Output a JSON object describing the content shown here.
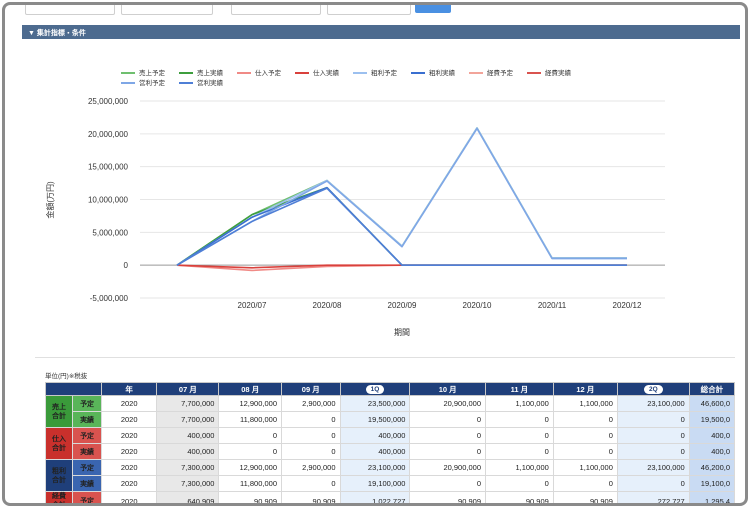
{
  "filters": {
    "field1_placeholder": "",
    "field2_placeholder": "",
    "field3_placeholder": "",
    "field4_placeholder": ""
  },
  "section": {
    "title": "▼ 集計指標・条件"
  },
  "legend": [
    {
      "label": "売上予定",
      "color": "#6fbf6f"
    },
    {
      "label": "売上実績",
      "color": "#3e9e3e"
    },
    {
      "label": "仕入予定",
      "color": "#f08a86"
    },
    {
      "label": "仕入実績",
      "color": "#d9413c"
    },
    {
      "label": "粗利予定",
      "color": "#9cc0ef"
    },
    {
      "label": "粗利実績",
      "color": "#3a6fd0"
    },
    {
      "label": "経費予定",
      "color": "#f2a49a"
    },
    {
      "label": "経費実績",
      "color": "#d9534f"
    },
    {
      "label": "営利予定",
      "color": "#7fa7e6"
    },
    {
      "label": "営利実績",
      "color": "#4f7fd6"
    }
  ],
  "chart_data": {
    "type": "line",
    "x": [
      "",
      "2020/07",
      "2020/08",
      "2020/09",
      "2020/10",
      "2020/11",
      "2020/12"
    ],
    "ylabel": "金額(万円)",
    "xlabel": "期間",
    "ylim": [
      -5000000,
      25000000
    ],
    "yticks": [
      "25,000,000",
      "20,000,000",
      "15,000,000",
      "10,000,000",
      "5,000,000",
      "0",
      "-5,000,000"
    ],
    "series": [
      {
        "name": "売上予定",
        "color": "#6fbf6f",
        "values": [
          0,
          7700000,
          12900000,
          2900000,
          20900000,
          1100000,
          1100000
        ]
      },
      {
        "name": "売上実績",
        "color": "#3e9e3e",
        "values": [
          0,
          7700000,
          11800000,
          0,
          0,
          0,
          0
        ]
      },
      {
        "name": "仕入予定",
        "color": "#f08a86",
        "values": [
          0,
          -800000,
          -200000,
          0,
          0,
          0,
          0
        ]
      },
      {
        "name": "仕入実績",
        "color": "#d9413c",
        "values": [
          0,
          -400000,
          0,
          0,
          0,
          0,
          0
        ]
      },
      {
        "name": "粗利予定",
        "color": "#9cc0ef",
        "values": [
          0,
          7300000,
          12900000,
          2900000,
          20900000,
          1100000,
          1100000
        ]
      },
      {
        "name": "粗利実績",
        "color": "#3a6fd0",
        "values": [
          0,
          7300000,
          11800000,
          0,
          0,
          0,
          0
        ]
      },
      {
        "name": "営利予定",
        "color": "#7fa7e6",
        "values": [
          0,
          6660000,
          12810000,
          2810000,
          20810000,
          1010000,
          1010000
        ]
      },
      {
        "name": "営利実績",
        "color": "#4f7fd6",
        "values": [
          0,
          6660000,
          11710000,
          0,
          0,
          0,
          0
        ]
      }
    ]
  },
  "table": {
    "unit_label": "単位(円)※税抜",
    "headers": [
      "年",
      "07 月",
      "08 月",
      "09 月",
      "1Q",
      "10 月",
      "11 月",
      "12 月",
      "2Q",
      "総合計"
    ],
    "groups": [
      {
        "name": "売上\n合計",
        "color": "green",
        "rows": [
          {
            "sub": "予定",
            "values": [
              "2020",
              "7,700,000",
              "12,900,000",
              "2,900,000",
              "23,500,000",
              "20,900,000",
              "1,100,000",
              "1,100,000",
              "23,100,000",
              "46,600,0"
            ]
          },
          {
            "sub": "実績",
            "values": [
              "2020",
              "7,700,000",
              "11,800,000",
              "0",
              "19,500,000",
              "0",
              "0",
              "0",
              "0",
              "19,500,0"
            ]
          }
        ]
      },
      {
        "name": "仕入\n合計",
        "color": "red",
        "rows": [
          {
            "sub": "予定",
            "values": [
              "2020",
              "400,000",
              "0",
              "0",
              "400,000",
              "0",
              "0",
              "0",
              "0",
              "400,0"
            ]
          },
          {
            "sub": "実績",
            "values": [
              "2020",
              "400,000",
              "0",
              "0",
              "400,000",
              "0",
              "0",
              "0",
              "0",
              "400,0"
            ]
          }
        ]
      },
      {
        "name": "粗利\n合計",
        "color": "blue",
        "rows": [
          {
            "sub": "予定",
            "values": [
              "2020",
              "7,300,000",
              "12,900,000",
              "2,900,000",
              "23,100,000",
              "20,900,000",
              "1,100,000",
              "1,100,000",
              "23,100,000",
              "46,200,0"
            ]
          },
          {
            "sub": "実績",
            "values": [
              "2020",
              "7,300,000",
              "11,800,000",
              "0",
              "19,100,000",
              "0",
              "0",
              "0",
              "0",
              "19,100,0"
            ]
          }
        ]
      },
      {
        "name": "経費\n合計",
        "color": "red",
        "rows": [
          {
            "sub": "予定",
            "values": [
              "2020",
              "640,909",
              "90,909",
              "90,909",
              "1,022,727",
              "90,909",
              "90,909",
              "90,909",
              "272,727",
              "1,295,4"
            ]
          }
        ]
      }
    ]
  }
}
